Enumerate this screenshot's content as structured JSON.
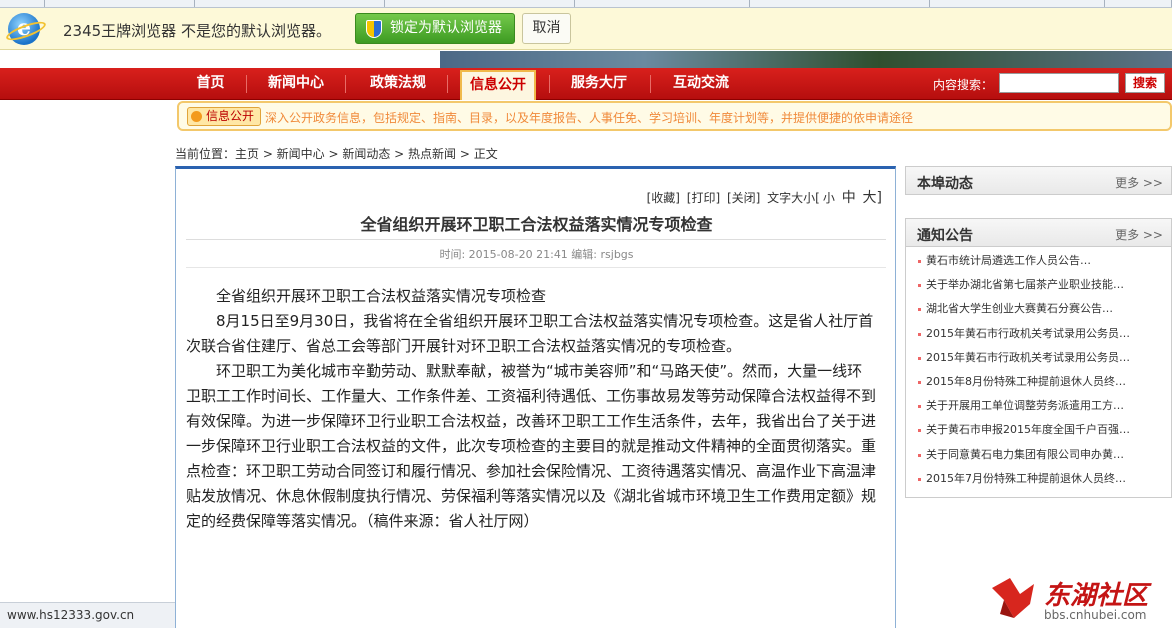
{
  "browser": {
    "infobar_text": "2345王牌浏览器 不是您的默认浏览器。",
    "lock_button": "锁定为默认浏览器",
    "cancel_button": "取消",
    "status_url": "www.hs12333.gov.cn"
  },
  "nav": {
    "items": [
      "首页",
      "新闻中心",
      "政策法规",
      "信息公开",
      "服务大厅",
      "互动交流"
    ],
    "active": "信息公开",
    "search_label": "内容搜索：",
    "search_value": "",
    "search_button": "搜索"
  },
  "subbar": {
    "badge": "信息公开",
    "text": "深入公开政务信息，包括规定、指南、目录，以及年度报告、人事任免、学习培训、年度计划等，并提供便捷的依申请途径"
  },
  "breadcrumb": "当前位置：主页 > 新闻中心 > 新闻动态 > 热点新闻 > 正文",
  "article": {
    "tools": {
      "favorite": "[收藏]",
      "print": "[打印]",
      "close": "[关闭]",
      "font_label": "文字大小[",
      "small": "小",
      "medium": "中",
      "large": "大]"
    },
    "title": "全省组织开展环卫职工合法权益落实情况专项检查",
    "meta": "时间: 2015-08-20 21:41 编辑: rsjbgs",
    "paragraphs": [
      "全省组织开展环卫职工合法权益落实情况专项检查",
      "8月15日至9月30日，我省将在全省组织开展环卫职工合法权益落实情况专项检查。这是省人社厅首次联合省住建厅、省总工会等部门开展针对环卫职工合法权益落实情况的专项检查。",
      "环卫职工为美化城市辛勤劳动、默默奉献，被誉为“城市美容师”和“马路天使”。然而，大量一线环卫职工工作时间长、工作量大、工作条件差、工资福利待遇低、工伤事故易发等劳动保障合法权益得不到有效保障。为进一步保障环卫行业职工合法权益，改善环卫职工工作生活条件，去年，我省出台了关于进一步保障环卫行业职工合法权益的文件，此次专项检查的主要目的就是推动文件精神的全面贯彻落实。重点检查：环卫职工劳动合同签订和履行情况、参加社会保险情况、工资待遇落实情况、高温作业下高温津贴发放情况、休息休假制度执行情况、劳保福利等落实情况以及《湖北省城市环境卫生工作费用定额》规定的经费保障等落实情况。（稿件来源：省人社厅网）"
    ]
  },
  "sidebar": {
    "local_news": {
      "title": "本埠动态",
      "more": "更多 >>"
    },
    "notices": {
      "title": "通知公告",
      "more": "更多 >>",
      "items": [
        "黄石市统计局遴选工作人员公告…",
        "关于举办湖北省第七届茶产业职业技能…",
        "湖北省大学生创业大赛黄石分赛公告…",
        "2015年黄石市行政机关考试录用公务员…",
        "2015年黄石市行政机关考试录用公务员…",
        "2015年8月份特殊工种提前退休人员终…",
        "关于开展用工单位调整劳务派遣用工方…",
        "关于黄石市申报2015年度全国千户百强…",
        "关于同意黄石电力集团有限公司申办黄…",
        "2015年7月份特殊工种提前退休人员终…"
      ]
    }
  },
  "watermark": {
    "name": "东湖社区",
    "url": "bbs.cnhubei.com"
  },
  "colors": {
    "nav_red": "#c81414",
    "accent_orange": "#f08a3a",
    "link_blue": "#2a62b0"
  }
}
